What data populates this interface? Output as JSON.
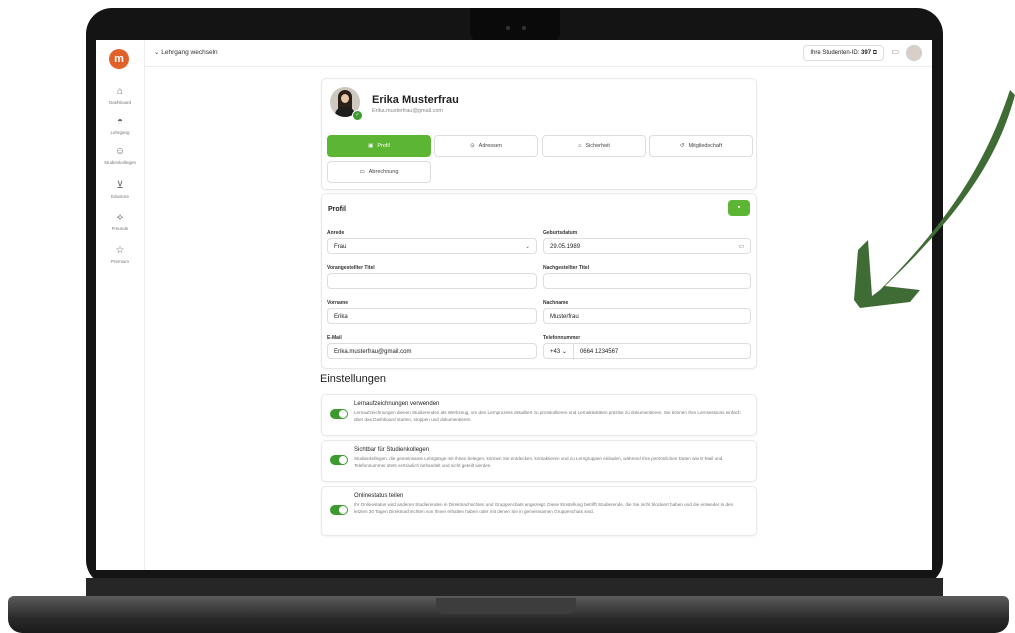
{
  "topbar": {
    "course_switch": "Lehrgang wechseln",
    "student_id_label": "Ihre Studenten-ID:",
    "student_id_value": "397"
  },
  "sidebar": {
    "items": [
      {
        "label": "Dashboard",
        "icon": "home-icon"
      },
      {
        "label": "Lehrgang",
        "icon": "bag-icon"
      },
      {
        "label": "Studienkollegen",
        "icon": "users-icon"
      },
      {
        "label": "Edustore",
        "icon": "cart-icon"
      },
      {
        "label": "Freunde",
        "icon": "friends-icon"
      },
      {
        "label": "Premium",
        "icon": "star-icon"
      }
    ]
  },
  "profile": {
    "name": "Erika Musterfrau",
    "email": "Erika.musterfrau@gmail.com"
  },
  "tabs": [
    {
      "label": "Profil",
      "active": true
    },
    {
      "label": "Adressen",
      "active": false
    },
    {
      "label": "Sicherheit",
      "active": false
    },
    {
      "label": "Mitgliedschaft",
      "active": false
    },
    {
      "label": "Abrechnung",
      "active": false
    }
  ],
  "form": {
    "title": "Profil",
    "anrede_label": "Anrede",
    "anrede_value": "Frau",
    "geburtsdatum_label": "Geburtsdatum",
    "geburtsdatum_value": "29.05.1989",
    "vortitel_label": "Vorangestellter Titel",
    "nachtitel_label": "Nachgestellter Titel",
    "vorname_label": "Vorname",
    "vorname_value": "Erika",
    "nachname_label": "Nachname",
    "nachname_value": "Musterfrau",
    "email_label": "E-Mail",
    "email_value": "Erika.musterfrau@gmail.com",
    "telefon_label": "Telefonnummer",
    "telefon_prefix": "+43",
    "telefon_value": "0664 1234567"
  },
  "settings": {
    "heading": "Einstellungen",
    "items": [
      {
        "title": "Lernaufzeichnungen verwenden",
        "description": "Lernaufzeichnungen dienen Studierenden als Werkzeug, um den Lernprozess detailliert zu protokollieren und Lernaktivitäten präzise zu dokumentieren. Sie können Ihre Lernsessions einfach über das Dashboard starten, stoppen und dokumentieren.",
        "enabled": true
      },
      {
        "title": "Sichtbar für Studienkollegen",
        "description": "Studienkollegen, die gemeinsame Lehrgänge mit Ihnen belegen, können Sie entdecken, kontaktieren und zu Lerngruppen einladen, während Ihre persönlichen Daten wie E-Mail und Telefonnummer stets vertraulich behandelt und nicht geteilt werden.",
        "enabled": true
      },
      {
        "title": "Onlinestatus teilen",
        "description": "Ihr Onlinestatus wird anderen Studierenden in Direktnachrichten und Gruppenchats angezeigt. Diese Einstellung betrifft Studierende, die Sie nicht blockiert haben und die entweder in den letzten 30 Tagen Direktnachrichten von Ihnen erhalten haben oder mit denen Sie in gemeinsamen Gruppenchats sind.",
        "enabled": true
      }
    ]
  },
  "colors": {
    "accent": "#5cb533",
    "brand": "#e2612a",
    "arrow": "#3f6b35"
  }
}
